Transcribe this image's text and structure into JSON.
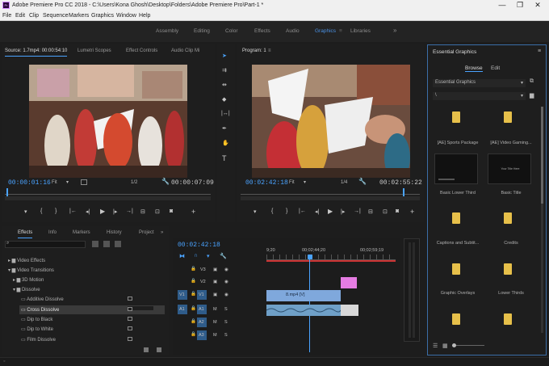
{
  "window": {
    "title": "Adobe Premiere Pro CC 2018 - C:\\Users\\Kona Ghosh\\Desktop\\Folders\\Adobe Premiere Pro\\Part-1 *",
    "app_icon": "Pr",
    "minimize": "—",
    "restore": "❐",
    "close": "✕"
  },
  "menu": [
    "File",
    "Edit",
    "Clip",
    "Sequence",
    "Markers",
    "Graphics",
    "Window",
    "Help"
  ],
  "workspaces": {
    "items": [
      "Assembly",
      "Editing",
      "Color",
      "Effects",
      "Audio",
      "Graphics",
      "Libraries"
    ],
    "active": "Graphics",
    "more": "»"
  },
  "source_monitor": {
    "tabs": [
      "Source: 1.7mp4: 00:00:54:10",
      "Lumetri Scopes",
      "Effect Controls",
      "Audio Clip Mi"
    ],
    "timecode_in": "00:00:01:16",
    "fit": "Fit",
    "scale": "1/2",
    "duration": "00:00:07:09"
  },
  "program_monitor": {
    "tab": "Program: 1",
    "timecode": "00:02:42:18",
    "fit": "Fit",
    "scale": "1/4",
    "duration": "00:02:55:22"
  },
  "tools": [
    "selection-tool",
    "track-select-tool",
    "ripple-edit-tool",
    "razor-tool",
    "slip-tool",
    "pen-tool",
    "hand-tool",
    "type-tool"
  ],
  "effects_panel": {
    "tabs": [
      "Effects",
      "Info",
      "Markers",
      "History",
      "Project"
    ],
    "tree": [
      {
        "label": "Video Effects",
        "indent": 0,
        "icon": "folder"
      },
      {
        "label": "Video Transitions",
        "indent": 0,
        "icon": "folder"
      },
      {
        "label": "3D Motion",
        "indent": 1,
        "icon": "folder"
      },
      {
        "label": "Dissolve",
        "indent": 1,
        "icon": "folder"
      },
      {
        "label": "Additive Dissolve",
        "indent": 2,
        "icon": "item"
      },
      {
        "label": "Cross Dissolve",
        "indent": 2,
        "icon": "item",
        "selected": true
      },
      {
        "label": "Dip to Black",
        "indent": 2,
        "icon": "item"
      },
      {
        "label": "Dip to White",
        "indent": 2,
        "icon": "item"
      },
      {
        "label": "Film Dissolve",
        "indent": 2,
        "icon": "item"
      }
    ]
  },
  "timeline": {
    "timecode": "00:02:42:18",
    "ruler": {
      "left": "9;20",
      "mid": "00;02;44;20",
      "right": "00;02;59;19"
    },
    "tracks": [
      {
        "name": "V3"
      },
      {
        "name": "V2"
      },
      {
        "name": "V1",
        "src": "V1"
      },
      {
        "name": "A1",
        "src": "A1"
      },
      {
        "name": "A2"
      },
      {
        "name": "A3"
      }
    ],
    "clip_label": "8.mp4 [V]"
  },
  "essential_graphics": {
    "title": "Essential Graphics",
    "tabs": [
      "Browse",
      "Edit"
    ],
    "active_tab": "Browse",
    "dropdown": "Essential Graphics",
    "path": "\\",
    "items": [
      {
        "label": "[AE] Sports Package",
        "kind": "folder"
      },
      {
        "label": "[AE] Video Gaming...",
        "kind": "folder"
      },
      {
        "label": "Basic Lower Third",
        "kind": "thumb"
      },
      {
        "label": "Basic Title",
        "kind": "thumb",
        "thumb_text": "Your Title Here"
      },
      {
        "label": "Captions and Subtit...",
        "kind": "folder"
      },
      {
        "label": "Credits",
        "kind": "folder"
      },
      {
        "label": "Graphic Overlays",
        "kind": "folder"
      },
      {
        "label": "Lower Thirds",
        "kind": "folder"
      },
      {
        "label": "",
        "kind": "folder"
      },
      {
        "label": "",
        "kind": "folder"
      }
    ]
  },
  "colors": {
    "accent": "#4aa3ff",
    "video_clip": "#7fa8dc",
    "audio_clip": "#6fa0c8",
    "transition": "#e57ce2",
    "playhead": "#4aa3ff"
  }
}
